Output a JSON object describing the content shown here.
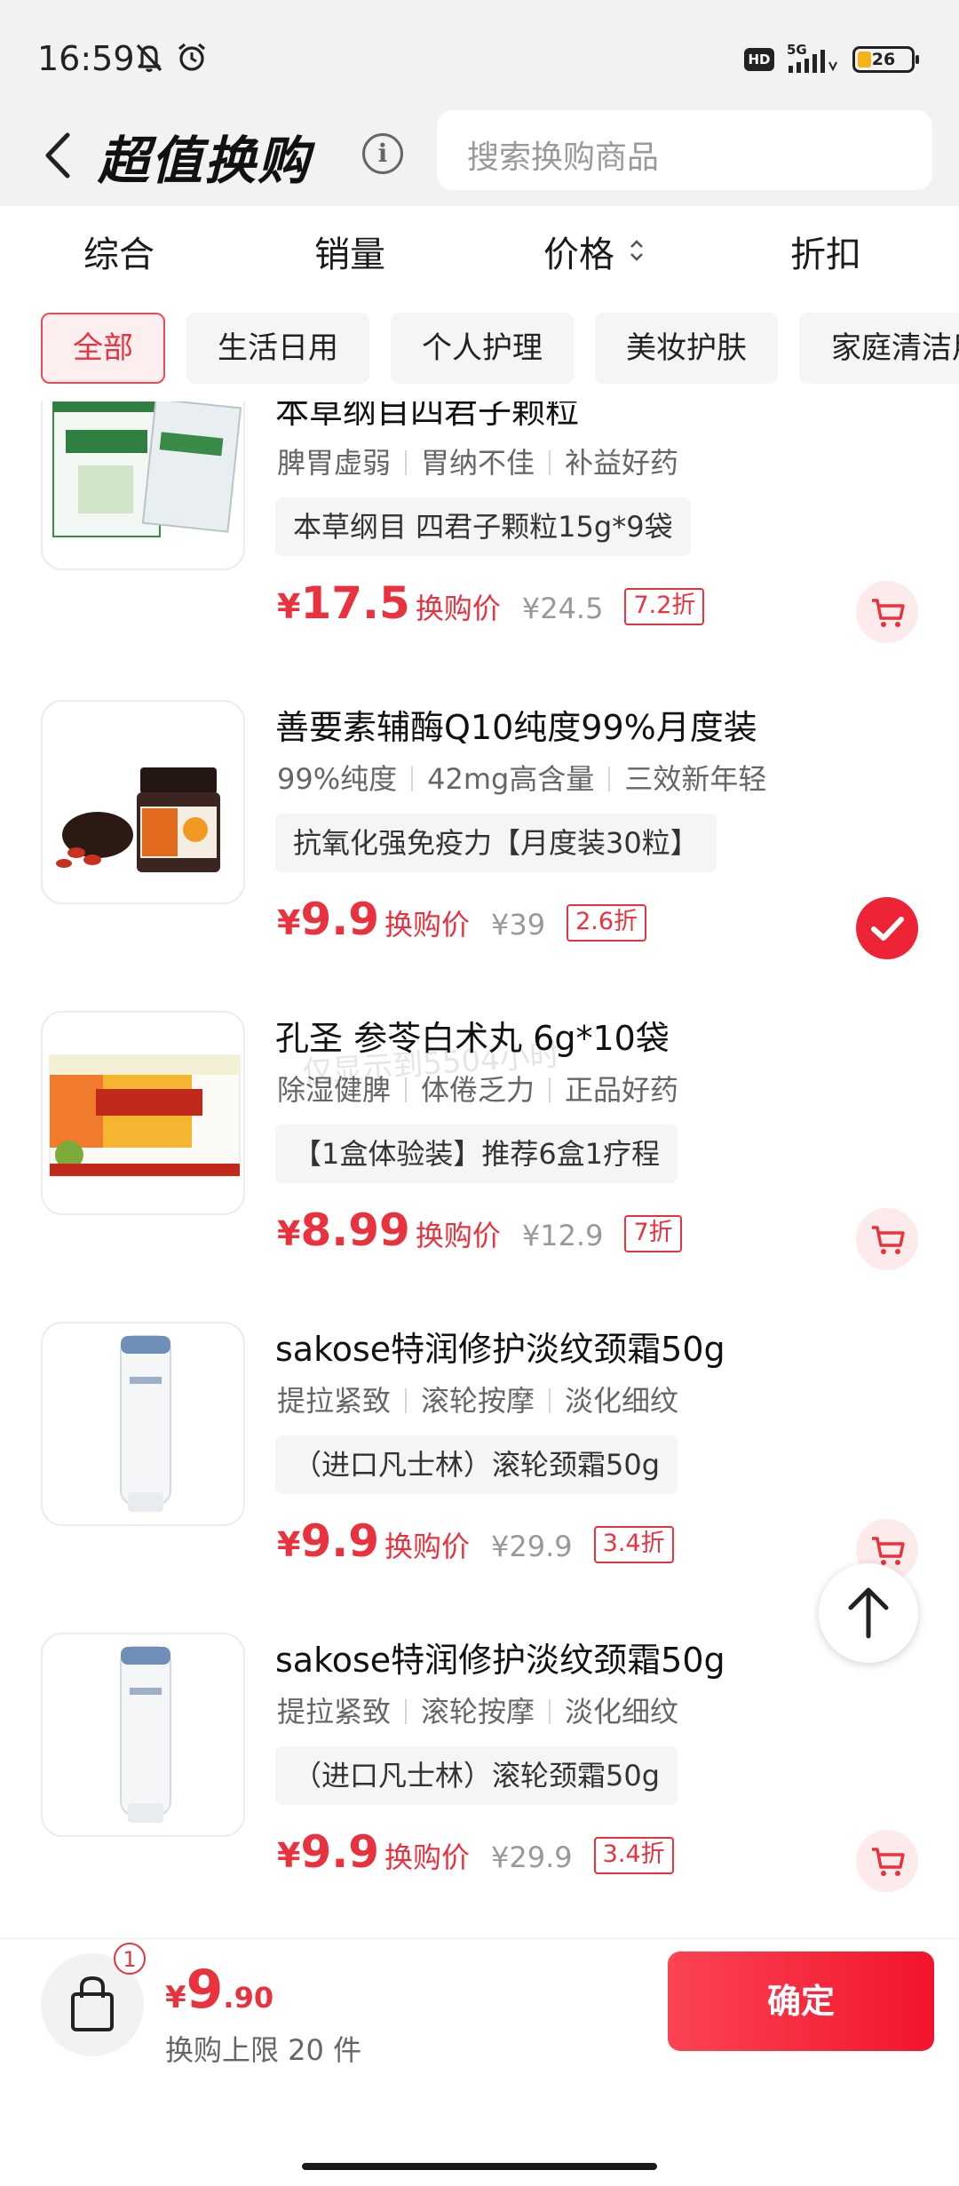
{
  "status_bar": {
    "time": "16:59",
    "hd": "HD",
    "network": "5G",
    "battery": "26",
    "battery_level": 0.26,
    "icons": [
      "bell-off-icon",
      "alarm-clock-icon",
      "signal-icon",
      "battery-icon"
    ]
  },
  "header": {
    "title": "超值换购",
    "search_placeholder": "搜索换购商品"
  },
  "sort_tabs": [
    "综合",
    "销量",
    "价格",
    "折扣"
  ],
  "categories": {
    "active_index": 0,
    "items": [
      "全部",
      "生活日用",
      "个人护理",
      "美妆护肤",
      "家庭清洁用品"
    ]
  },
  "products": [
    {
      "name": "本草纲目四君子颗粒",
      "tags": [
        "脾胃虚弱",
        "胃纳不佳",
        "补益好药"
      ],
      "spec": "本草纲目 四君子颗粒15g*9袋",
      "price": "17.5",
      "price_label": "换购价",
      "original": "¥24.5",
      "discount": "7.2折",
      "selected": false
    },
    {
      "name": "善要素辅酶Q10纯度99%月度装",
      "tags": [
        "99%纯度",
        "42mg高含量",
        "三效新年轻"
      ],
      "spec": "抗氧化强免疫力【月度装30粒】",
      "price": "9.9",
      "price_label": "换购价",
      "original": "¥39",
      "discount": "2.6折",
      "selected": true
    },
    {
      "name": "孔圣 参苓白术丸 6g*10袋",
      "tags": [
        "除湿健脾",
        "体倦乏力",
        "正品好药"
      ],
      "spec": "【1盒体验装】推荐6盒1疗程",
      "price": "8.99",
      "price_label": "换购价",
      "original": "¥12.9",
      "discount": "7折",
      "selected": false
    },
    {
      "name": "sakose特润修护淡纹颈霜50g",
      "tags": [
        "提拉紧致",
        "滚轮按摩",
        "淡化细纹"
      ],
      "spec": "（进口凡士林）滚轮颈霜50g",
      "price": "9.9",
      "price_label": "换购价",
      "original": "¥29.9",
      "discount": "3.4折",
      "selected": false
    },
    {
      "name": "sakose特润修护淡纹颈霜50g",
      "tags": [
        "提拉紧致",
        "滚轮按摩",
        "淡化细纹"
      ],
      "spec": "（进口凡士林）滚轮颈霜50g",
      "price": "9.9",
      "price_label": "换购价",
      "original": "¥29.9",
      "discount": "3.4折",
      "selected": false
    }
  ],
  "watermark": "仅显示到5504小时",
  "bottom": {
    "bag_count": "1",
    "currency": "¥",
    "total_int": "9",
    "total_dec": ".90",
    "limit": "换购上限 20 件",
    "confirm": "确定"
  },
  "colors": {
    "accent": "#e8333f",
    "header_bg": "#f2f2f4",
    "chip_bg": "#f4f5f7"
  }
}
